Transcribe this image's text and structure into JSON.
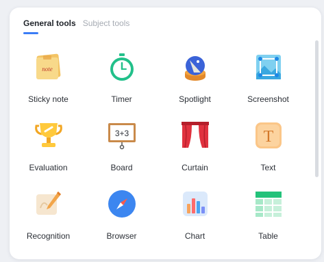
{
  "tabs": {
    "general": "General tools",
    "subject": "Subject tools"
  },
  "tools": [
    {
      "label": "Sticky note",
      "icon": "sticky-note-icon",
      "icon_text": "note"
    },
    {
      "label": "Timer",
      "icon": "timer-icon"
    },
    {
      "label": "Spotlight",
      "icon": "spotlight-icon"
    },
    {
      "label": "Screenshot",
      "icon": "screenshot-icon"
    },
    {
      "label": "Evaluation",
      "icon": "trophy-icon"
    },
    {
      "label": "Board",
      "icon": "board-icon",
      "icon_text": "3+3"
    },
    {
      "label": "Curtain",
      "icon": "curtain-icon"
    },
    {
      "label": "Text",
      "icon": "text-icon",
      "icon_text": "T"
    },
    {
      "label": "Recognition",
      "icon": "recognition-icon"
    },
    {
      "label": "Browser",
      "icon": "compass-icon"
    },
    {
      "label": "Chart",
      "icon": "chart-icon"
    },
    {
      "label": "Table",
      "icon": "table-icon"
    }
  ],
  "colors": {
    "accent": "#3a7cf6",
    "active_tab": "#1f2329",
    "inactive_tab": "#a6abb3"
  }
}
